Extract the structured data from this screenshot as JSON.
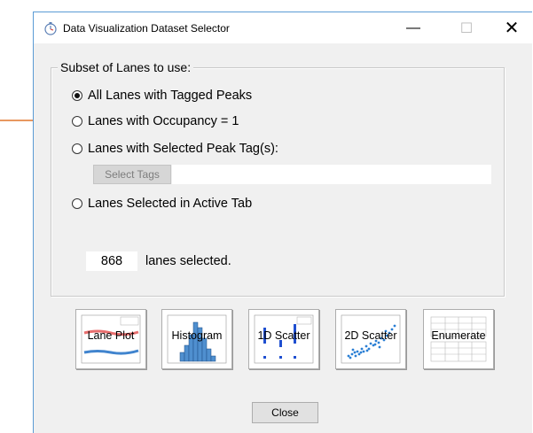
{
  "window": {
    "title": "Data Visualization Dataset Selector"
  },
  "controls": {
    "minimize": "—",
    "maximize": "☐",
    "close": "✕"
  },
  "group": {
    "legend": "Subset of Lanes to use:",
    "options": [
      {
        "label": "All Lanes with Tagged Peaks",
        "checked": true
      },
      {
        "label": "Lanes with Occupancy = 1",
        "checked": false
      },
      {
        "label": "Lanes with Selected Peak Tag(s):",
        "checked": false
      },
      {
        "label": "Lanes Selected in Active Tab",
        "checked": false
      }
    ],
    "select_tags_label": "Select Tags",
    "tags_value": "",
    "lanes_count": "868",
    "lanes_label": "lanes selected."
  },
  "viz_buttons": [
    {
      "label": "Lane Plot",
      "icon": "lane-plot-icon"
    },
    {
      "label": "Histogram",
      "icon": "histogram-icon"
    },
    {
      "label": "1D Scatter",
      "icon": "scatter-1d-icon"
    },
    {
      "label": "2D Scatter",
      "icon": "scatter-2d-icon"
    },
    {
      "label": "Enumerate",
      "icon": "table-icon"
    }
  ],
  "close_label": "Close",
  "colors": {
    "accent": "#5b9bd5",
    "arrow": "#e0772c",
    "plot_blue": "#1f6fc5",
    "plot_red": "#e24a4a"
  }
}
